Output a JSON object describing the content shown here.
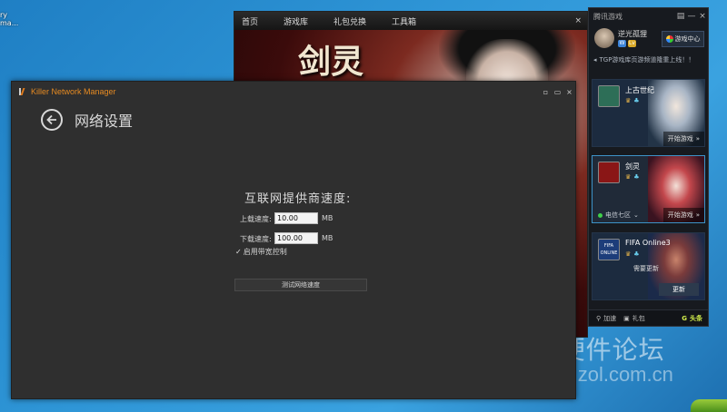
{
  "desktop": {
    "icon_label_1": "ry",
    "icon_label_2": "ma...",
    "watermark_title": "DIY硬件论坛",
    "watermark_url": "diybbs.zol.com.cn"
  },
  "game_browser": {
    "tabs": [
      "首页",
      "游戏库",
      "礼包兑换",
      "工具箱"
    ],
    "close": "×",
    "banner_title": "剑灵"
  },
  "qq_panel": {
    "title": "腾讯游戏",
    "controls": [
      "▤",
      "—",
      "×"
    ],
    "username": "逆光孤狸",
    "badges": [
      "W",
      "Lv"
    ],
    "game_center": "游戏中心",
    "notice": "TGP游戏库页游频道隆重上线！！",
    "cards": [
      {
        "name": "上古世纪",
        "action": "开始游戏"
      },
      {
        "name": "剑灵",
        "server": "电信七区",
        "action": "开始游戏"
      },
      {
        "name": "FIFA Online3",
        "status": "需要更新",
        "action": "更新",
        "logo": "FIFA ONLINE"
      }
    ],
    "bottom": {
      "speed": "加速",
      "gift": "礼包",
      "news": "头条"
    }
  },
  "killer": {
    "app_name": "Killer Network Manager",
    "controls": [
      "▫",
      "▭",
      "×"
    ],
    "page_title": "网络设置",
    "section_title": "互联网提供商速度:",
    "upload_label": "上载速度:",
    "upload_value": "10.00",
    "download_label": "下载速度:",
    "download_value": "100.00",
    "unit": "MB",
    "bandwidth_checked": true,
    "bandwidth_label": "启用带宽控制",
    "test_button": "测试网络速度"
  },
  "colors": {
    "accent_orange": "#e58a22",
    "window_bg": "#2f2f2f",
    "panel_bg": "#171a1f",
    "desktop_blue": "#2e95d6"
  }
}
